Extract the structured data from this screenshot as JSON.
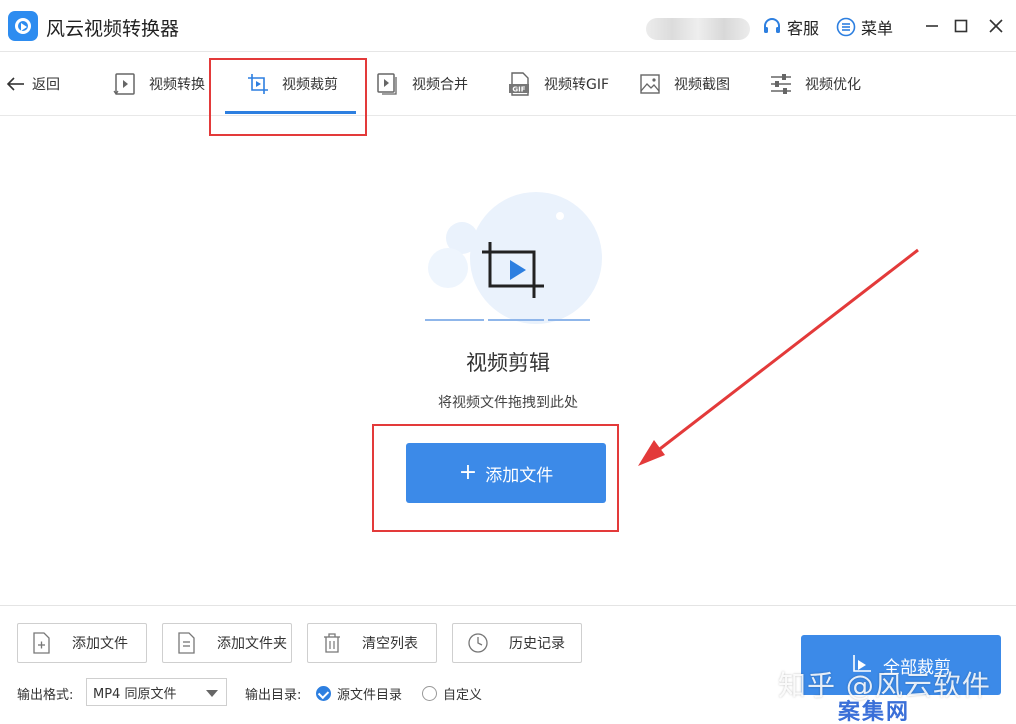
{
  "app": {
    "title": "风云视频转换器"
  },
  "titlebar": {
    "service_label": "客服",
    "menu_label": "菜单"
  },
  "nav": {
    "back_label": "返回",
    "tabs": [
      {
        "label": "视频转换"
      },
      {
        "label": "视频裁剪"
      },
      {
        "label": "视频合并"
      },
      {
        "label": "视频转GIF"
      },
      {
        "label": "视频截图"
      },
      {
        "label": "视频优化"
      }
    ],
    "active_tab": "视频裁剪"
  },
  "main": {
    "title": "视频剪辑",
    "hint": "将视频文件拖拽到此处",
    "add_button_label": "添加文件",
    "add_button_icon": "+"
  },
  "bottom": {
    "buttons": [
      {
        "label": "添加文件"
      },
      {
        "label": "添加文件夹"
      },
      {
        "label": "清空列表"
      },
      {
        "label": "历史记录"
      }
    ],
    "format_label": "输出格式:",
    "format_value": "MP4 同原文件",
    "dir_label": "输出目录:",
    "dir_options": [
      {
        "label": "源文件目录",
        "selected": true
      },
      {
        "label": "自定义",
        "selected": false
      }
    ],
    "start_button_label": "全部裁剪"
  },
  "watermark": {
    "line1": "知乎 @风云软件",
    "line2": "案集网"
  },
  "colors": {
    "accent": "#3c8ae8",
    "highlight": "#e33a3a"
  }
}
